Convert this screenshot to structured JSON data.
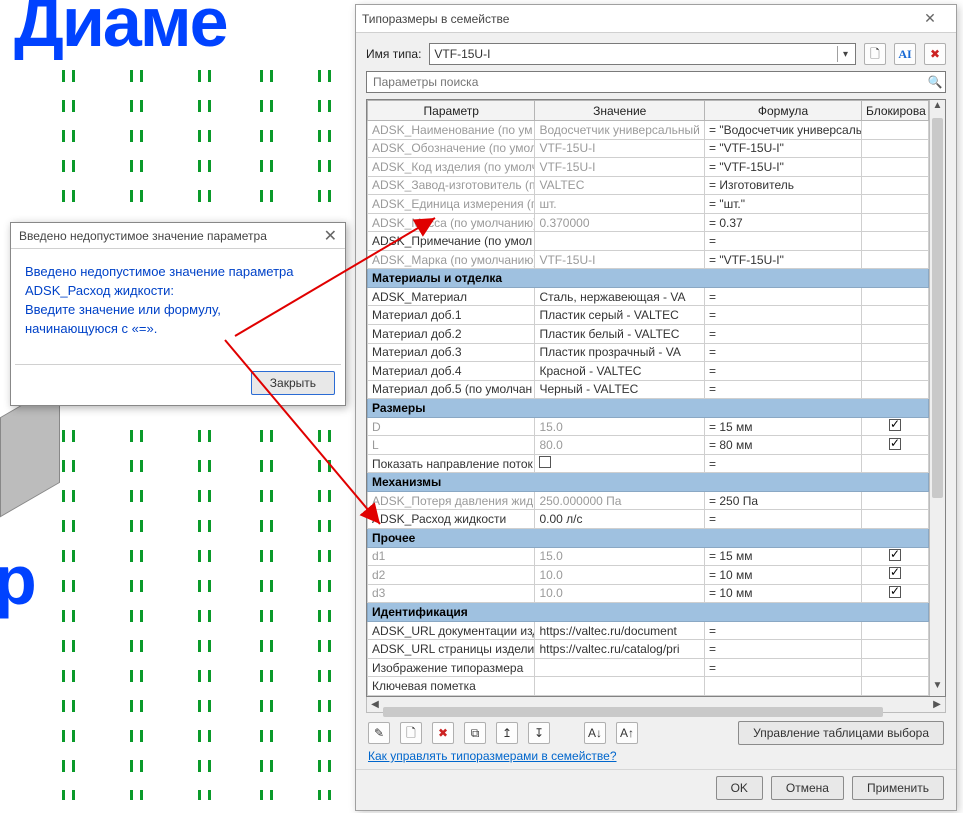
{
  "canvas_text_1": "Диаме",
  "canvas_text_2": "р",
  "dialog": {
    "title": "Типоразмеры в семействе",
    "type_label": "Имя типа:",
    "type_value": "VTF-15U-І",
    "search_placeholder": "Параметры поиска",
    "headers": {
      "param": "Параметр",
      "value": "Значение",
      "formula": "Формула",
      "lock": "Блокирова"
    },
    "rows": [
      {
        "kind": "dim",
        "param": "ADSK_Наименование (по ум",
        "value": "Водосчетчик универсальный",
        "formula": "= \"Водосчетчик универсальны",
        "lock": ""
      },
      {
        "kind": "dim",
        "param": "ADSK_Обозначение (по умол",
        "value": "VTF-15U-І",
        "formula": "= \"VTF-15U-І\"",
        "lock": ""
      },
      {
        "kind": "dim",
        "param": "ADSK_Код изделия (по умолч",
        "value": "VTF-15U-І",
        "formula": "= \"VTF-15U-І\"",
        "lock": ""
      },
      {
        "kind": "dim",
        "param": "ADSK_Завод-изготовитель (п",
        "value": "VALTEC",
        "formula": "= Изготовитель",
        "lock": ""
      },
      {
        "kind": "dim",
        "param": "ADSK_Единица измерения (п",
        "value": "шт.",
        "formula": "= \"шт.\"",
        "lock": ""
      },
      {
        "kind": "dim",
        "param": "ADSK_Масса (по умолчанию)",
        "value": "0.370000",
        "formula": "= 0.37",
        "lock": ""
      },
      {
        "kind": "row",
        "param": "ADSK_Примечание (по умол",
        "value": "",
        "formula": "=",
        "lock": ""
      },
      {
        "kind": "dim",
        "param": "ADSK_Марка (по умолчанию)",
        "value": "VTF-15U-І",
        "formula": "= \"VTF-15U-І\"",
        "lock": ""
      },
      {
        "kind": "group",
        "param": "Материалы и отделка"
      },
      {
        "kind": "row",
        "param": "ADSK_Материал",
        "value": "Сталь, нержавеющая - VA",
        "formula": "=",
        "lock": ""
      },
      {
        "kind": "row",
        "param": "Материал доб.1",
        "value": "Пластик серый - VALTEC",
        "formula": "=",
        "lock": ""
      },
      {
        "kind": "row",
        "param": "Материал доб.2",
        "value": "Пластик белый - VALTEC",
        "formula": "=",
        "lock": ""
      },
      {
        "kind": "row",
        "param": "Материал доб.3",
        "value": "Пластик прозрачный - VA",
        "formula": "=",
        "lock": ""
      },
      {
        "kind": "row",
        "param": "Материал доб.4",
        "value": "Красной - VALTEC",
        "formula": "=",
        "lock": ""
      },
      {
        "kind": "row",
        "param": "Материал доб.5 (по умолчан",
        "value": "Черный - VALTEC",
        "formula": "=",
        "lock": ""
      },
      {
        "kind": "group",
        "param": "Размеры"
      },
      {
        "kind": "dim",
        "param": "D",
        "value": "15.0",
        "formula": "= 15 мм",
        "lock": "checked"
      },
      {
        "kind": "dim",
        "param": "L",
        "value": "80.0",
        "formula": "= 80 мм",
        "lock": "checked"
      },
      {
        "kind": "row",
        "param": "Показать направление поток",
        "value": "□",
        "formula": "=",
        "lock": ""
      },
      {
        "kind": "group",
        "param": "Механизмы"
      },
      {
        "kind": "dim",
        "param": "ADSK_Потеря давления жидк",
        "value": "250.000000 Па",
        "formula": "= 250 Па",
        "lock": ""
      },
      {
        "kind": "row",
        "param": "ADSK_Расход жидкости",
        "value": "0.00 л/с",
        "formula": "=",
        "lock": ""
      },
      {
        "kind": "group",
        "param": "Прочее"
      },
      {
        "kind": "dim",
        "param": "d1",
        "value": "15.0",
        "formula": "= 15 мм",
        "lock": "checked"
      },
      {
        "kind": "dim",
        "param": "d2",
        "value": "10.0",
        "formula": "= 10 мм",
        "lock": "checked"
      },
      {
        "kind": "dim",
        "param": "d3",
        "value": "10.0",
        "formula": "= 10 мм",
        "lock": "checked"
      },
      {
        "kind": "group",
        "param": "Идентификация"
      },
      {
        "kind": "row",
        "param": "ADSK_URL документации изд",
        "value": "https://valtec.ru/document",
        "formula": "=",
        "lock": ""
      },
      {
        "kind": "row",
        "param": "ADSK_URL страницы изделия",
        "value": "https://valtec.ru/catalog/pri",
        "formula": "=",
        "lock": ""
      },
      {
        "kind": "row",
        "param": "Изображение типоразмера",
        "value": "",
        "formula": "=",
        "lock": ""
      },
      {
        "kind": "row",
        "param": "Ключевая пометка",
        "value": "",
        "formula": "",
        "lock": ""
      }
    ],
    "manage_tables": "Управление таблицами выбора",
    "help_link": "Как управлять типоразмерами в семействе?",
    "ok": "OK",
    "cancel": "Отмена",
    "apply": "Применить"
  },
  "error": {
    "title": "Введено недопустимое значение параметра",
    "line1": "Введено недопустимое значение параметра",
    "line2": "ADSK_Расход жидкости:",
    "line3": "Введите значение или формулу,",
    "line4": "начинающуюся с «=».",
    "close": "Закрыть"
  }
}
